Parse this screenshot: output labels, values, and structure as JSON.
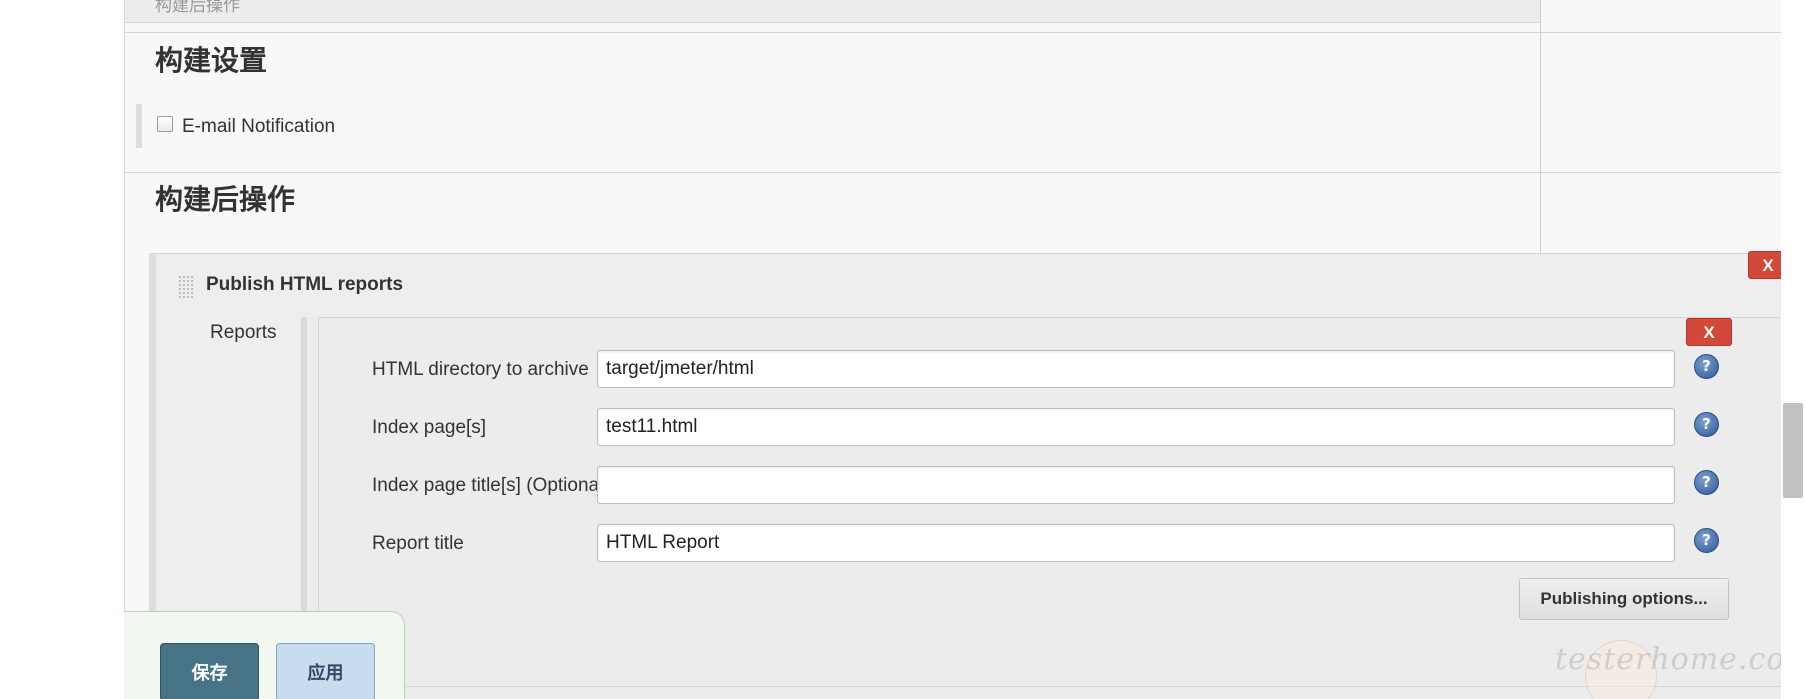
{
  "sections": {
    "top_title_partial": "构建后操作",
    "build_settings_title": "构建设置",
    "post_build_title": "构建后操作"
  },
  "email_notification": {
    "label": "E-mail Notification",
    "checked": false
  },
  "publisher": {
    "title": "Publish HTML reports",
    "delete_label": "X",
    "reports_label": "Reports",
    "report": {
      "delete_label": "X",
      "fields": [
        {
          "label": "HTML directory to archive",
          "value": "target/jmeter/html",
          "placeholder": ""
        },
        {
          "label": "Index page[s]",
          "value": "test11.html",
          "placeholder": ""
        },
        {
          "label": "Index page title[s] (Optional)",
          "value": "",
          "placeholder": ""
        },
        {
          "label": "Report title",
          "value": "HTML Report",
          "placeholder": ""
        }
      ],
      "publishing_options_label": "Publishing options..."
    }
  },
  "footer": {
    "save_label": "保存",
    "apply_label": "应用"
  },
  "watermark": "testerhome.com",
  "icons": {
    "help": "help-icon",
    "drag": "drag-handle-icon"
  },
  "colors": {
    "delete_red": "#d24939",
    "save_teal": "#467385",
    "apply_blue": "#c9dcef",
    "help_blue": "#2d5895"
  }
}
